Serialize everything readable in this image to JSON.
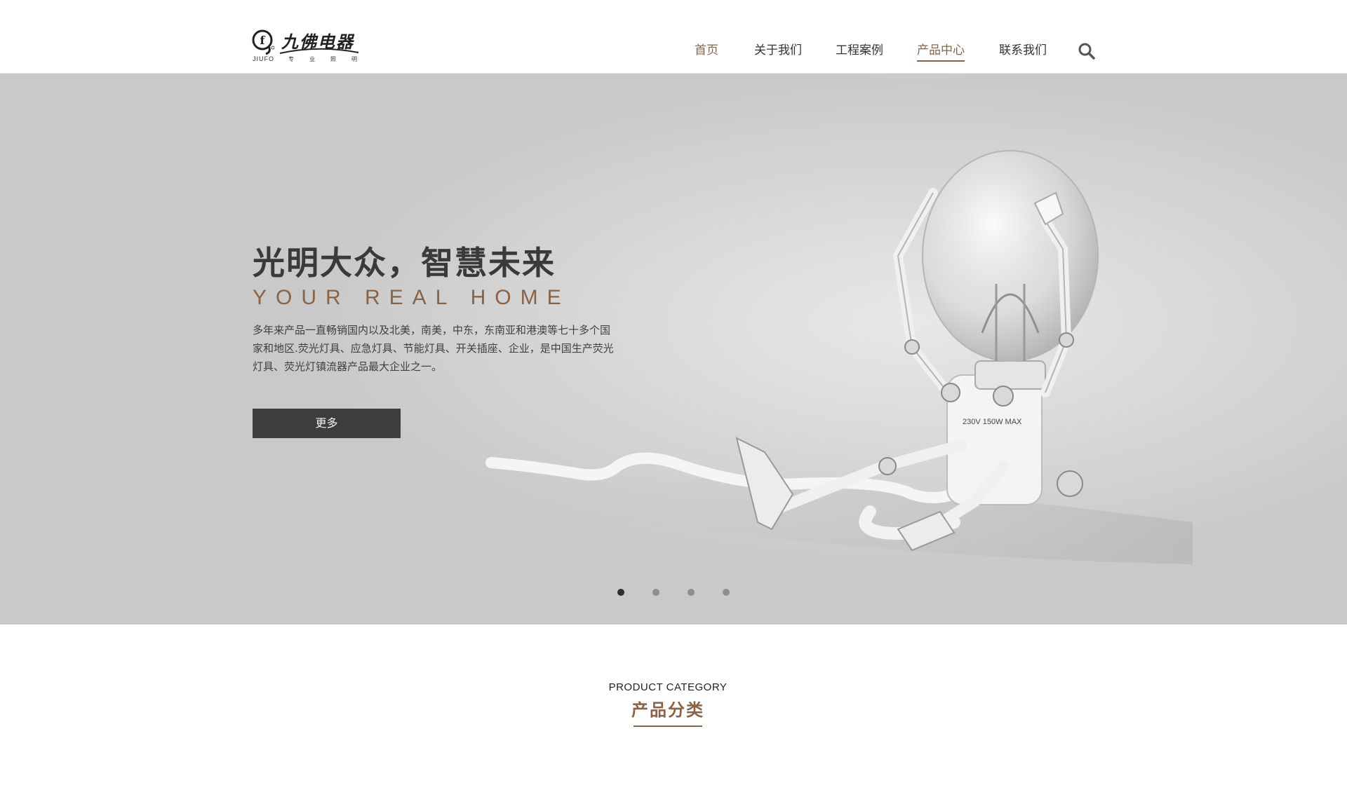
{
  "header": {
    "logo": {
      "cn_text": "九佛电器",
      "en_text": "JIUFO",
      "tagline": "专业照明"
    },
    "nav": [
      {
        "label": "首页",
        "state": "home"
      },
      {
        "label": "关于我们",
        "state": "default"
      },
      {
        "label": "工程案例",
        "state": "default"
      },
      {
        "label": "产品中心",
        "state": "active"
      },
      {
        "label": "联系我们",
        "state": "default"
      }
    ],
    "search_icon": "search-icon"
  },
  "banner": {
    "title": "光明大众，智慧未来",
    "subtitle": "YOUR REAL HOME",
    "description": "多年来产品一直畅销国内以及北美，南美，中东，东南亚和港澳等七十多个国家和地区.荧光灯具、应急灯具、节能灯具、开关插座、企业，是中国生产荧光灯具、荧光灯镇流器产品最大企业之一。",
    "button_label": "更多",
    "slides_total": 4,
    "active_slide": 1,
    "image_label": "230V 150W MAX"
  },
  "product_category": {
    "title_en": "PRODUCT CATEGORY",
    "title_cn": "产品分类"
  },
  "colors": {
    "accent": "#8a6347",
    "banner_bg": "#c9c9c9",
    "button_bg": "#3d3d3d",
    "text": "#333333"
  }
}
